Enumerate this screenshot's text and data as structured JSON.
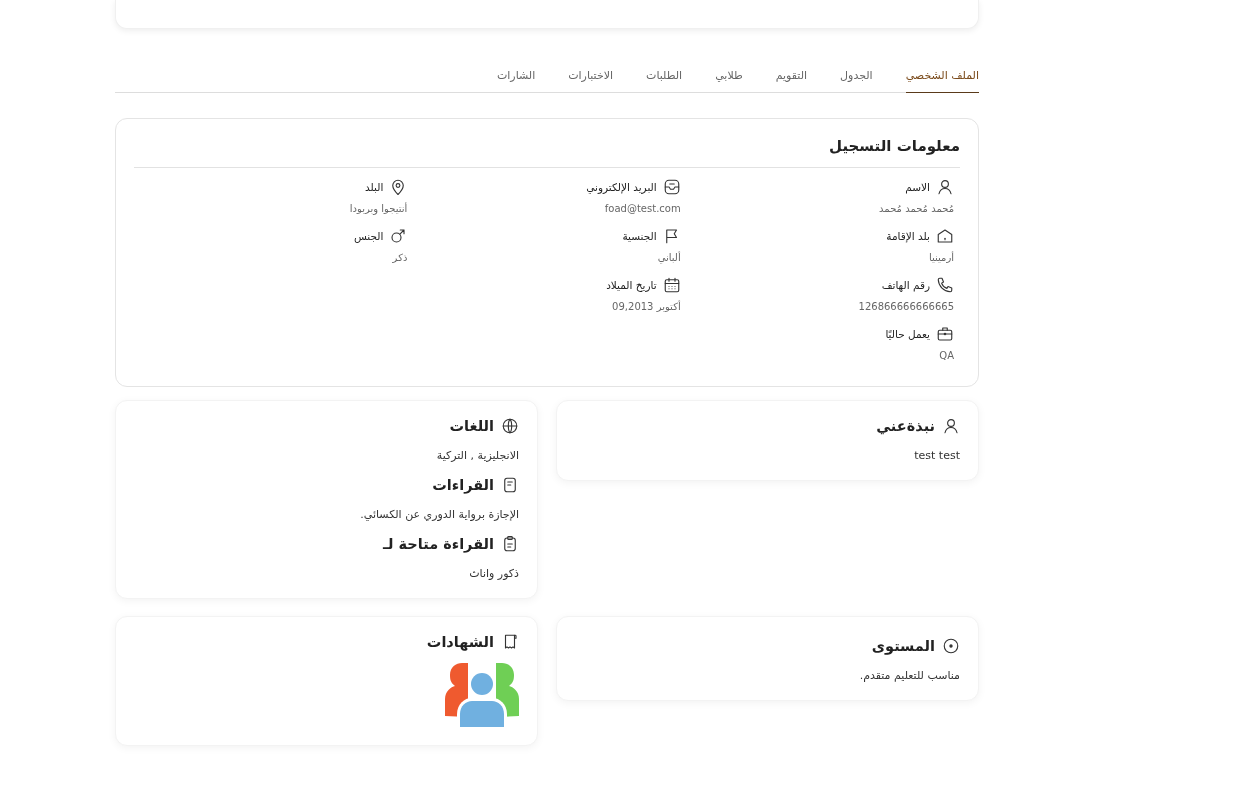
{
  "tabs": [
    {
      "label": "الملف الشخصي",
      "selected": true
    },
    {
      "label": "الجدول",
      "selected": false
    },
    {
      "label": "التقويم",
      "selected": false
    },
    {
      "label": "طلابي",
      "selected": false
    },
    {
      "label": "الطلبات",
      "selected": false
    },
    {
      "label": "الاختبارات",
      "selected": false
    },
    {
      "label": "الشارات",
      "selected": false
    }
  ],
  "registration": {
    "title": "معلومات التسجيل",
    "columns": [
      [
        {
          "label": "الاسم",
          "value": "مُحمد مُحمد مُحمد"
        },
        {
          "label": "بلد الإقامة",
          "value": "أرمينيا"
        },
        {
          "label": "رقم الهاتف",
          "value": "126866666666665"
        },
        {
          "label": "يعمل حاليًا",
          "value": "QA"
        }
      ],
      [
        {
          "label": "البريد الإلكتروني",
          "value": "foad@test.com"
        },
        {
          "label": "الجنسية",
          "value": "ألباني"
        },
        {
          "label": "تاريخ الميلاد",
          "value": "أكتوبر 09,2013"
        }
      ],
      [
        {
          "label": "البلد",
          "value": "أنتيجوا وبربودا"
        },
        {
          "label": "الجنس",
          "value": "ذكر"
        }
      ]
    ]
  },
  "about": {
    "title": "نبذةعني",
    "text": "test test"
  },
  "languages": {
    "sections": [
      {
        "title": "اللغات",
        "text": "الانجليزية , التركية"
      },
      {
        "title": "القراءات",
        "text": "الإجازة برواية الدوري عن الكسائي."
      },
      {
        "title": "القراءة متاحة لـ",
        "text": "ذكور واناث"
      }
    ]
  },
  "level": {
    "title": "المستوى",
    "text": "مناسب للتعليم متقدم."
  },
  "certificates": {
    "title": "الشهادات"
  }
}
